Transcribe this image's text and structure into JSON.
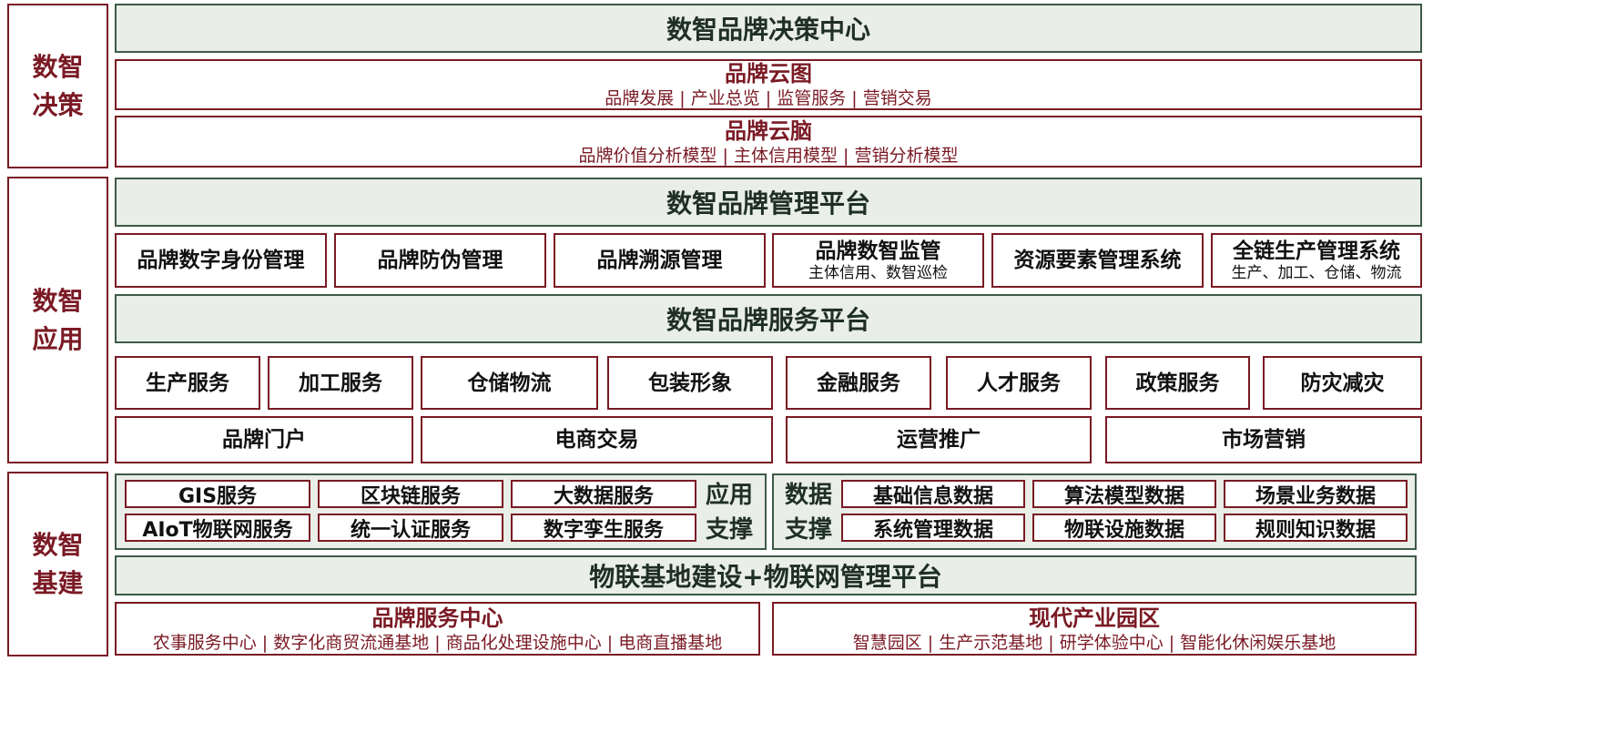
{
  "side_labels": {
    "decision": [
      "数智",
      "决策"
    ],
    "application": [
      "数智",
      "应用"
    ],
    "infrastructure": [
      "数智",
      "基建"
    ]
  },
  "decision": {
    "center_title": "数智品牌决策中心",
    "cloud_map": {
      "title": "品牌云图",
      "items": "品牌发展 | 产业总览 | 监管服务 | 营销交易"
    },
    "cloud_brain": {
      "title": "品牌云脑",
      "items": "品牌价值分析模型 | 主体信用模型 | 营销分析模型"
    }
  },
  "application": {
    "mgmt_platform": "数智品牌管理平台",
    "mgmt_modules": [
      {
        "title": "品牌数字身份管理",
        "sub": ""
      },
      {
        "title": "品牌防伪管理",
        "sub": ""
      },
      {
        "title": "品牌溯源管理",
        "sub": ""
      },
      {
        "title": "品牌数智监管",
        "sub": "主体信用、数智巡检"
      },
      {
        "title": "资源要素管理系统",
        "sub": ""
      },
      {
        "title": "全链生产管理系统",
        "sub": "生产、加工、仓储、物流"
      }
    ],
    "service_platform": "数智品牌服务平台",
    "services_row1": [
      "生产服务",
      "加工服务",
      "仓储物流",
      "包装形象",
      "金融服务",
      "人才服务",
      "政策服务",
      "防灾减灾"
    ],
    "services_row2": [
      "品牌门户",
      "电商交易",
      "运营推广",
      "市场营销"
    ]
  },
  "infrastructure": {
    "app_support": {
      "label": [
        "应用",
        "支撑"
      ],
      "items": [
        "GIS服务",
        "区块链服务",
        "大数据服务",
        "AIoT物联网服务",
        "统一认证服务",
        "数字孪生服务"
      ]
    },
    "data_support": {
      "label": [
        "数据",
        "支撑"
      ],
      "items": [
        "基础信息数据",
        "算法模型数据",
        "场景业务数据",
        "系统管理数据",
        "物联设施数据",
        "规则知识数据"
      ]
    },
    "iot_platform": "物联基地建设+物联网管理平台",
    "brand_center": {
      "title": "品牌服务中心",
      "items": "农事服务中心 | 数字化商贸流通基地 | 商品化处理设施中心 | 电商直播基地"
    },
    "industrial_park": {
      "title": "现代产业园区",
      "items": "智慧园区 | 生产示范基地 | 研学体验中心 | 智能化休闲娱乐基地"
    }
  },
  "colors": {
    "accent": "#7a1a24",
    "panel_green": "#e9eee8",
    "panel_border": "#3d5a47"
  }
}
